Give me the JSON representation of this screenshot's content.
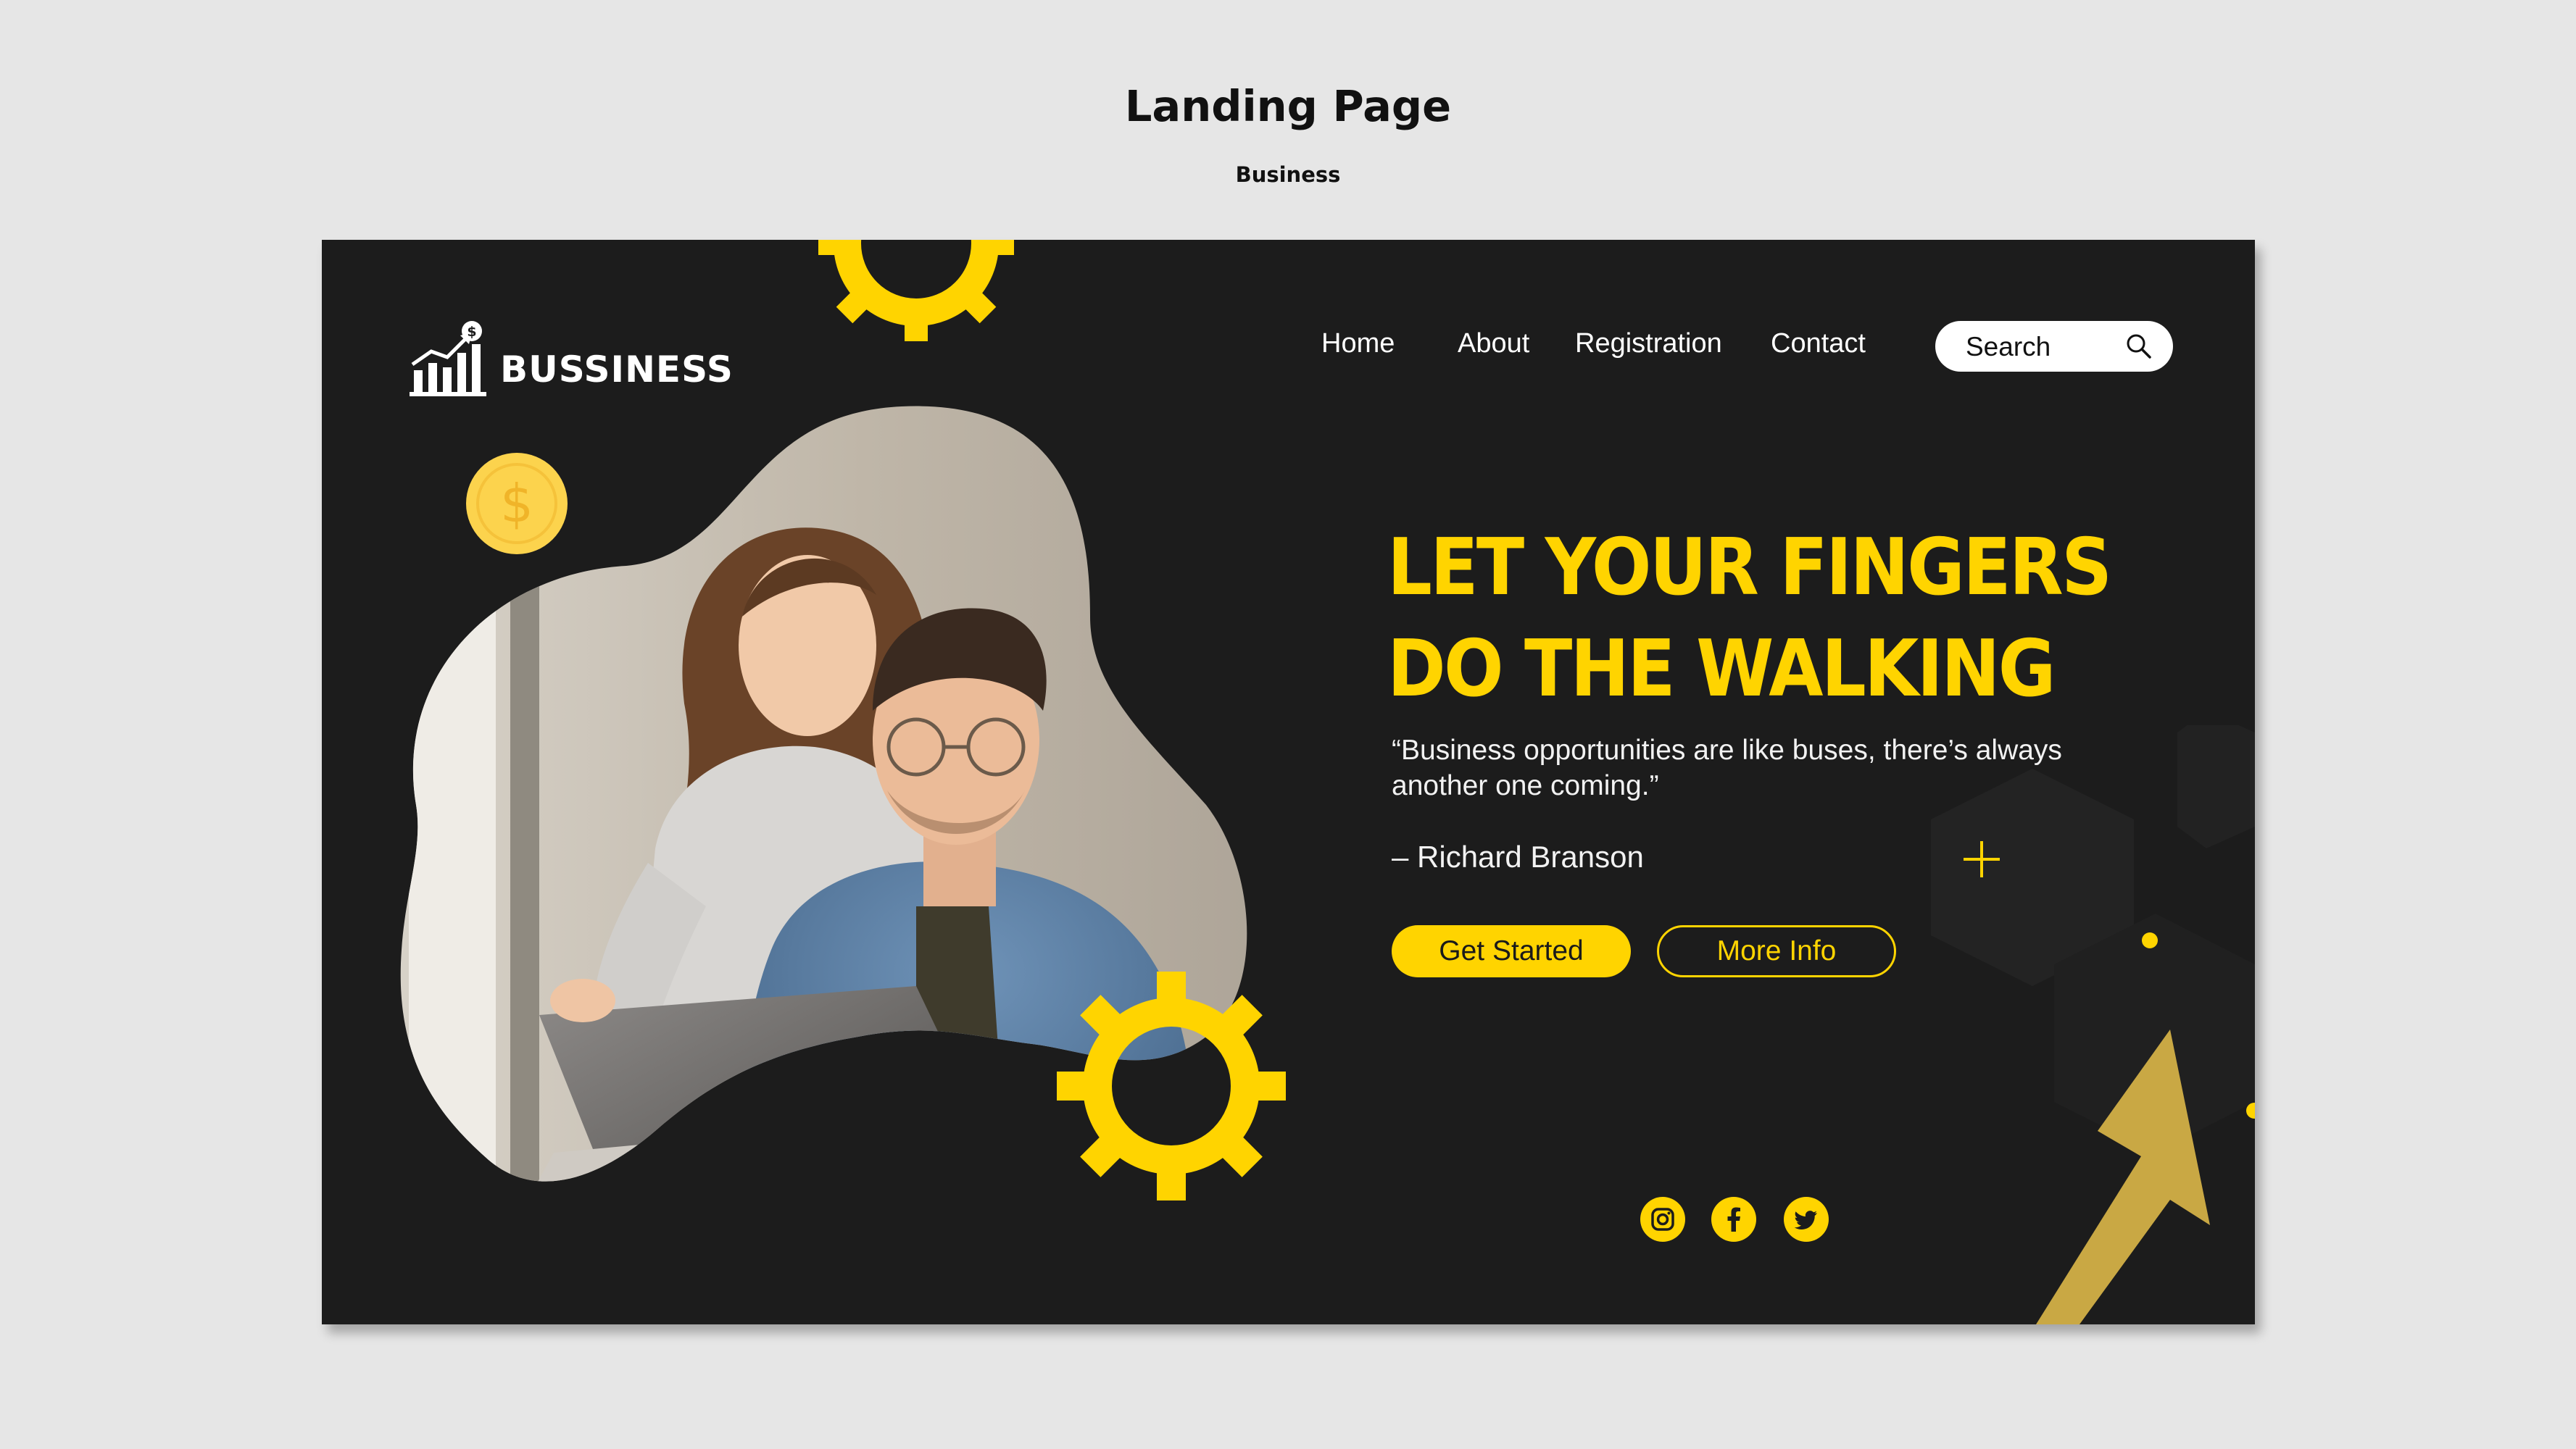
{
  "page": {
    "heading": "Landing Page",
    "subheading": "Business"
  },
  "brand": {
    "name": "BUSSINESS",
    "logo_icon": "growth-chart-dollar-icon"
  },
  "nav": {
    "items": [
      {
        "label": "Home"
      },
      {
        "label": "About"
      },
      {
        "label": "Registration"
      },
      {
        "label": "Contact"
      }
    ]
  },
  "search": {
    "placeholder": "Search",
    "icon": "search-icon"
  },
  "hero": {
    "headline_line1": "LET YOUR FINGERS",
    "headline_line2": "DO THE WALKING",
    "quote": "“Business opportunities are like buses, there’s always another one coming.”",
    "author": "– Richard Branson",
    "primary_button": "Get Started",
    "secondary_button": "More Info"
  },
  "social": [
    {
      "icon": "instagram-icon"
    },
    {
      "icon": "facebook-icon"
    },
    {
      "icon": "twitter-icon"
    }
  ],
  "colors": {
    "background": "#e6e6e6",
    "card": "#1c1c1c",
    "accent": "#ffd400",
    "coin": "#fcd34d",
    "arrow": "#c9a844"
  }
}
